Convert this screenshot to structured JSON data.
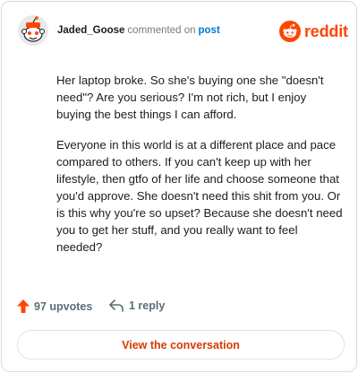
{
  "comment": {
    "author": "Jaded_Goose",
    "action_text": "commented on",
    "post_link": "post",
    "brand": "reddit",
    "paragraphs": [
      "Her laptop broke. So she's buying one she \"doesn't need\"? Are you serious? I'm not rich, but I enjoy buying the best things I can afford.",
      "Everyone in this world is at a different place and pace compared to others. If you can't keep up with her lifestyle, then gtfo of her life and choose someone that you'd approve. She doesn't need this shit from you. Or is this why you're so upset? Because she doesn't need you to get her stuff, and you really want to feel needed?"
    ],
    "upvotes": "97 upvotes",
    "replies": "1 reply",
    "cta": "View the conversation"
  },
  "icons": {
    "avatar": "snoo-avatar-icon",
    "brand": "reddit-logo-icon",
    "upvote": "upvote-arrow-icon",
    "reply": "reply-arrow-icon"
  },
  "colors": {
    "brand_orange": "#ff4500",
    "upvote_orange": "#ff4500",
    "link_blue": "#0079d3",
    "cta_text": "#d93900",
    "muted": "#576f76"
  }
}
